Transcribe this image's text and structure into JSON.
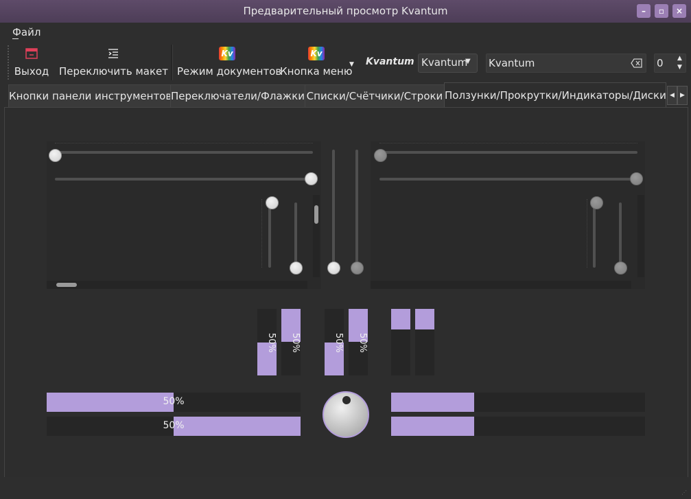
{
  "window": {
    "title": "Предварительный просмотр Kvantum",
    "minimize_icon": "minimize-icon",
    "maximize_icon": "maximize-icon",
    "close_icon": "close-icon",
    "accent": "#b39ddb"
  },
  "menubar": {
    "file": "Файл"
  },
  "toolbar": {
    "exit_label": "Выход",
    "switch_layout_label": "Переключить макет",
    "document_mode_label": "Режим документов",
    "menu_button_label": "Кнопка меню",
    "kv_logo": "Kv",
    "style_label": "Kvantum",
    "combo_value": "Kvantum",
    "line_edit_value": "Kvantum",
    "spin_value": "0"
  },
  "tabs": [
    {
      "label": "Кнопки панели инструментов"
    },
    {
      "label": "Переключатели/Флажки"
    },
    {
      "label": "Списки/Счётчики/Строки"
    },
    {
      "label": "Ползунки/Прокрутки/Индикаторы/Диски"
    }
  ],
  "sliders": {
    "horizontal_left_top": 0,
    "horizontal_left_bottom": 100,
    "horizontal_right_top": 0,
    "horizontal_right_bottom": 100
  },
  "progress": {
    "vertical_1": "50%",
    "vertical_2": "50%",
    "vertical_3": "50%",
    "vertical_4": "50%",
    "horizontal_1": "50%",
    "horizontal_2": "50%",
    "value_fraction": 0.5
  }
}
